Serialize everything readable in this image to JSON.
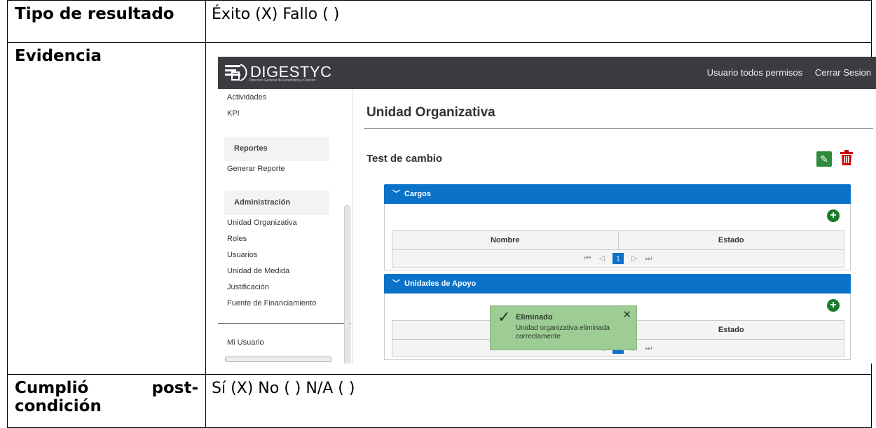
{
  "doc": {
    "row1": {
      "label": "Tipo de resultado",
      "value": "Éxito (X) Fallo ( )"
    },
    "row2": {
      "label": "Evidencia"
    },
    "row3": {
      "label_part1": "Cumplió",
      "label_part2": "post-",
      "label_part3": "condición",
      "value": "Sí (X) No ( )  N/A ( )"
    }
  },
  "app": {
    "brand": "DIGESTYC",
    "brand_sub": "Dirección General de Estadística y Censos",
    "user": "Usuario todos permisos",
    "logout": "Cerrar Sesion",
    "sidebar": {
      "top_items": [
        "Actividades",
        "KPI"
      ],
      "reports_header": "Reportes",
      "reports_items": [
        "Generar Reporte"
      ],
      "admin_header": "Administración",
      "admin_items": [
        "Unidad Organizativa",
        "Roles",
        "Usuarios",
        "Unidad de Medida",
        "Justificación",
        "Fuente de Financiamiento"
      ],
      "my_user": "Mi Usuario"
    },
    "main": {
      "title": "Unidad Organizativa",
      "entity": "Test de cambio",
      "panel1": {
        "title": "Cargos",
        "col1": "Nombre",
        "col2": "Estado",
        "page": "1"
      },
      "panel2": {
        "title": "Unidades de Apoyo",
        "col2": "Estado",
        "page": "1"
      }
    },
    "toast": {
      "title": "Eliminado",
      "message": "Unidad organizativa eliminada correctamente"
    },
    "colors": {
      "topbar": "#3a3c41",
      "accent": "#0a72c9",
      "toast": "#9dcc94",
      "add": "#1b7b2c",
      "delete": "#cc0000"
    }
  }
}
